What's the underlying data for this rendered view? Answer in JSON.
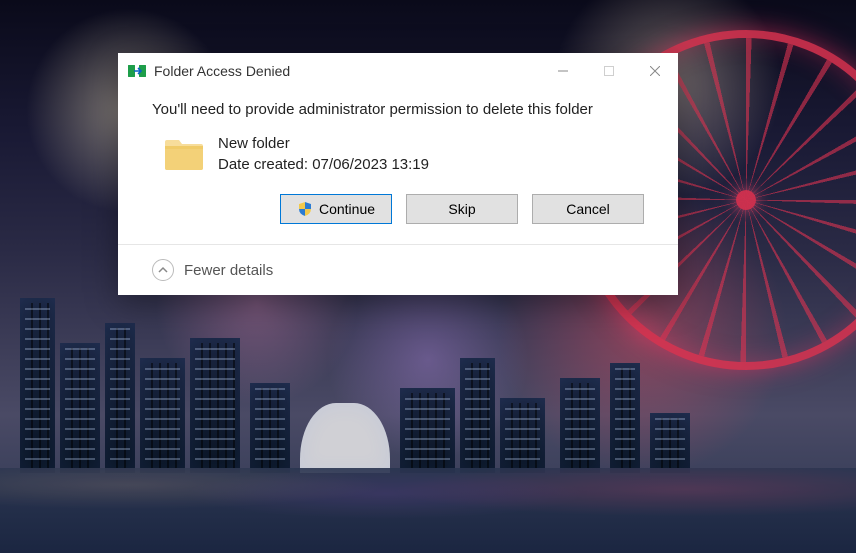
{
  "dialog": {
    "title": "Folder Access Denied",
    "message": "You'll need to provide administrator permission to delete this folder",
    "folder": {
      "name": "New folder",
      "date_created_label": "Date created: 07/06/2023 13:19"
    },
    "buttons": {
      "continue": "Continue",
      "skip": "Skip",
      "cancel": "Cancel"
    },
    "details_toggle": "Fewer details"
  }
}
